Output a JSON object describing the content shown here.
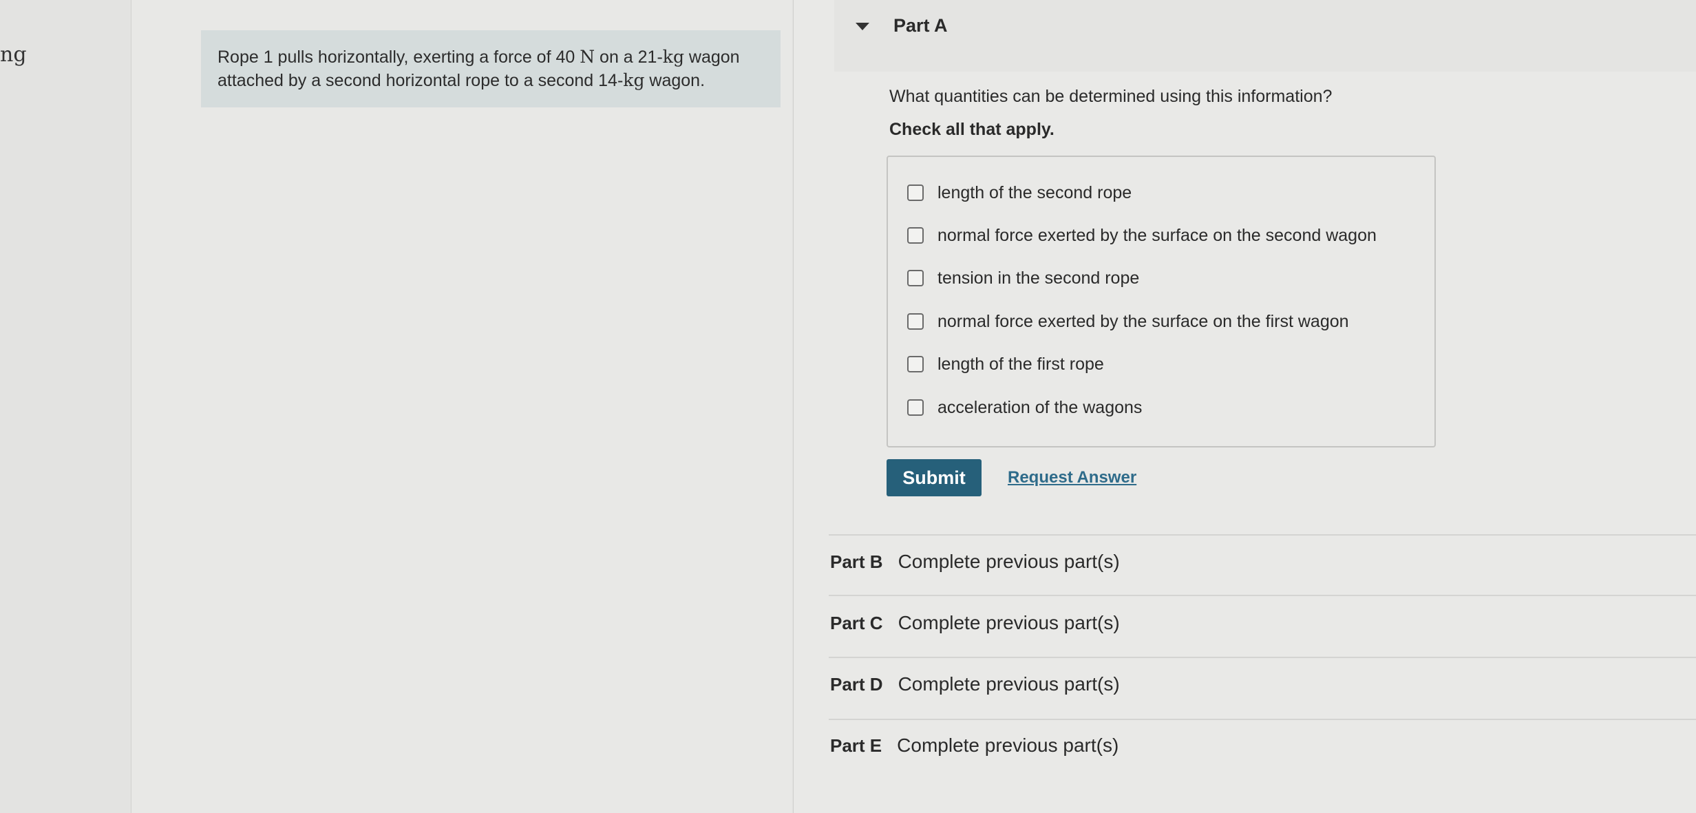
{
  "left_edge": {
    "text": "ng"
  },
  "problem": {
    "line1_a": "Rope 1 pulls horizontally, exerting a force of 40 ",
    "line1_unit_n": "N",
    "line1_b": " on a 21-",
    "line1_unit_kg": "kg",
    "line1_c": " wagon",
    "line2_a": "attached by a second horizontal rope to a second 14-",
    "line2_unit_kg": "kg",
    "line2_b": " wagon."
  },
  "part_a": {
    "title": "Part A",
    "question": "What quantities can be determined using this information?",
    "instruction": "Check all that apply.",
    "options": [
      {
        "label": "length of the second rope",
        "checked": false
      },
      {
        "label": "normal force exerted by the surface on the second wagon",
        "checked": false
      },
      {
        "label": "tension in the second rope",
        "checked": false
      },
      {
        "label": "normal force exerted by the surface on the first wagon",
        "checked": false
      },
      {
        "label": "length of the first rope",
        "checked": false
      },
      {
        "label": "acceleration of the wagons",
        "checked": false
      }
    ],
    "submit_label": "Submit",
    "request_answer_label": "Request Answer"
  },
  "parts": [
    {
      "label": "Part B",
      "status": "Complete previous part(s)"
    },
    {
      "label": "Part C",
      "status": "Complete previous part(s)"
    },
    {
      "label": "Part D",
      "status": "Complete previous part(s)"
    },
    {
      "label": "Part E",
      "status": "Complete previous part(s)"
    }
  ],
  "colors": {
    "submit_bg": "#26607a",
    "link": "#2e6b8a",
    "problem_bg": "#d5dcdc"
  }
}
